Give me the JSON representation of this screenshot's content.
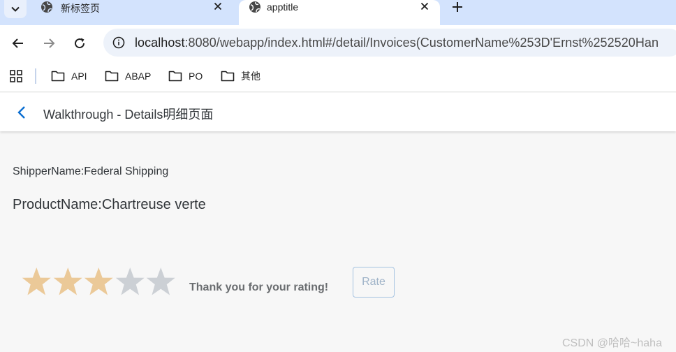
{
  "browser": {
    "tabs": [
      {
        "title": "新标签页",
        "active": false
      },
      {
        "title": "apptitle",
        "active": true
      }
    ],
    "address": {
      "host": "localhost",
      "path": ":8080/webapp/index.html#/detail/Invoices(CustomerName%253D'Ernst%252520Han"
    },
    "bookmarks": [
      "API",
      "ABAP",
      "PO",
      "其他"
    ]
  },
  "app": {
    "title": "Walkthrough - Details明细页面",
    "shipper": "ShipperName:Federal Shipping",
    "product": "ProductName:Chartreuse verte",
    "rating": {
      "value": 3,
      "max": 5
    },
    "thanks": "Thank you for your rating!",
    "rate_label": "Rate"
  },
  "watermark": "CSDN @哈哈~haha",
  "colors": {
    "tabstrip": "#d3e3fd",
    "star_filled": "#ebc998",
    "star_empty": "#ccd0d5",
    "accent": "#0a6ed1"
  }
}
